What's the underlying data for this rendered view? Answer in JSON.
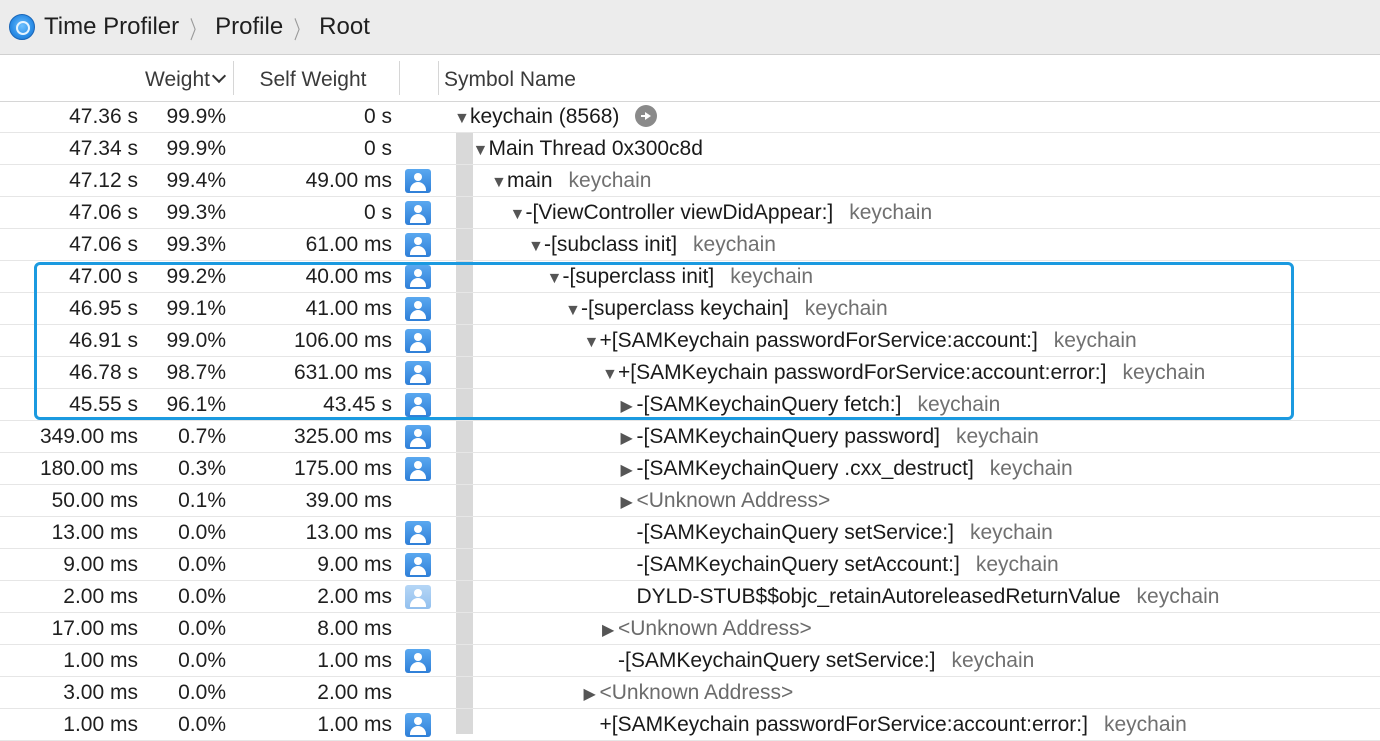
{
  "breadcrumb": {
    "app_icon": "time-profiler-icon",
    "items": [
      "Time Profiler",
      "Profile",
      "Root"
    ]
  },
  "columns": {
    "weight": "Weight",
    "self_weight": "Self Weight",
    "symbol_name": "Symbol Name"
  },
  "rows": [
    {
      "weight": "47.36 s",
      "percent": "99.9%",
      "self": "0 s",
      "user": false,
      "depth": 0,
      "expand": "open",
      "symbol": "keychain (8568)",
      "library": "",
      "go_arrow": true
    },
    {
      "weight": "47.34 s",
      "percent": "99.9%",
      "self": "0 s",
      "user": false,
      "depth": 1,
      "expand": "open",
      "symbol": "Main Thread  0x300c8d",
      "library": ""
    },
    {
      "weight": "47.12 s",
      "percent": "99.4%",
      "self": "49.00 ms",
      "user": true,
      "depth": 2,
      "expand": "open",
      "symbol": "main",
      "library": "keychain"
    },
    {
      "weight": "47.06 s",
      "percent": "99.3%",
      "self": "0 s",
      "user": true,
      "depth": 3,
      "expand": "open",
      "symbol": "-[ViewController viewDidAppear:]",
      "library": "keychain"
    },
    {
      "weight": "47.06 s",
      "percent": "99.3%",
      "self": "61.00 ms",
      "user": true,
      "depth": 4,
      "expand": "open",
      "symbol": "-[subclass init]",
      "library": "keychain"
    },
    {
      "weight": "47.00 s",
      "percent": "99.2%",
      "self": "40.00 ms",
      "user": true,
      "depth": 5,
      "expand": "open",
      "symbol": "-[superclass init]",
      "library": "keychain"
    },
    {
      "weight": "46.95 s",
      "percent": "99.1%",
      "self": "41.00 ms",
      "user": true,
      "depth": 6,
      "expand": "open",
      "symbol": "-[superclass keychain]",
      "library": "keychain"
    },
    {
      "weight": "46.91 s",
      "percent": "99.0%",
      "self": "106.00 ms",
      "user": true,
      "depth": 7,
      "expand": "open",
      "symbol": "+[SAMKeychain passwordForService:account:]",
      "library": "keychain"
    },
    {
      "weight": "46.78 s",
      "percent": "98.7%",
      "self": "631.00 ms",
      "user": true,
      "depth": 8,
      "expand": "open",
      "symbol": "+[SAMKeychain passwordForService:account:error:]",
      "library": "keychain"
    },
    {
      "weight": "45.55 s",
      "percent": "96.1%",
      "self": "43.45 s",
      "user": true,
      "depth": 9,
      "expand": "closed",
      "symbol": "-[SAMKeychainQuery fetch:]",
      "library": "keychain"
    },
    {
      "weight": "349.00 ms",
      "percent": "0.7%",
      "self": "325.00 ms",
      "user": true,
      "depth": 9,
      "expand": "closed",
      "symbol": "-[SAMKeychainQuery password]",
      "library": "keychain"
    },
    {
      "weight": "180.00 ms",
      "percent": "0.3%",
      "self": "175.00 ms",
      "user": true,
      "depth": 9,
      "expand": "closed",
      "symbol": "-[SAMKeychainQuery .cxx_destruct]",
      "library": "keychain"
    },
    {
      "weight": "50.00 ms",
      "percent": "0.1%",
      "self": "39.00 ms",
      "user": false,
      "depth": 9,
      "expand": "closed",
      "symbol": "<Unknown Address>",
      "library": "",
      "unknown": true
    },
    {
      "weight": "13.00 ms",
      "percent": "0.0%",
      "self": "13.00 ms",
      "user": true,
      "depth": 9,
      "expand": "none",
      "symbol": "-[SAMKeychainQuery setService:]",
      "library": "keychain"
    },
    {
      "weight": "9.00 ms",
      "percent": "0.0%",
      "self": "9.00 ms",
      "user": true,
      "depth": 9,
      "expand": "none",
      "symbol": "-[SAMKeychainQuery setAccount:]",
      "library": "keychain"
    },
    {
      "weight": "2.00 ms",
      "percent": "0.0%",
      "self": "2.00 ms",
      "user": "faded",
      "depth": 9,
      "expand": "none",
      "symbol": "DYLD-STUB$$objc_retainAutoreleasedReturnValue",
      "library": "keychain"
    },
    {
      "weight": "17.00 ms",
      "percent": "0.0%",
      "self": "8.00 ms",
      "user": false,
      "depth": 8,
      "expand": "closed",
      "symbol": "<Unknown Address>",
      "library": "",
      "unknown": true
    },
    {
      "weight": "1.00 ms",
      "percent": "0.0%",
      "self": "1.00 ms",
      "user": true,
      "depth": 8,
      "expand": "none",
      "symbol": "-[SAMKeychainQuery setService:]",
      "library": "keychain"
    },
    {
      "weight": "3.00 ms",
      "percent": "0.0%",
      "self": "2.00 ms",
      "user": false,
      "depth": 7,
      "expand": "closed",
      "symbol": "<Unknown Address>",
      "library": "",
      "unknown": true
    },
    {
      "weight": "1.00 ms",
      "percent": "0.0%",
      "self": "1.00 ms",
      "user": true,
      "depth": 7,
      "expand": "none",
      "symbol": "+[SAMKeychain passwordForService:account:error:]",
      "library": "keychain"
    }
  ],
  "colors": {
    "highlight_border": "#1b9ae0",
    "user_icon": "#2f7fd8",
    "library_text": "#707070"
  }
}
